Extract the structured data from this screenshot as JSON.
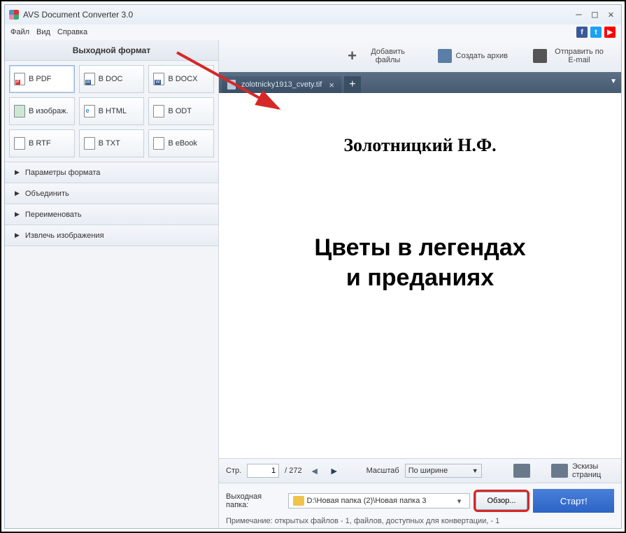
{
  "title": "AVS Document Converter 3.0",
  "menu": {
    "file": "Файл",
    "view": "Вид",
    "help": "Справка"
  },
  "sidebar": {
    "header": "Выходной формат",
    "formats": [
      {
        "label": "В PDF"
      },
      {
        "label": "В DOC"
      },
      {
        "label": "В DOCX"
      },
      {
        "label": "В изображ."
      },
      {
        "label": "В HTML"
      },
      {
        "label": "В ODT"
      },
      {
        "label": "В RTF"
      },
      {
        "label": "В TXT"
      },
      {
        "label": "В eBook"
      }
    ],
    "acc": [
      "Параметры формата",
      "Объединить",
      "Переименовать",
      "Извлечь изображения"
    ]
  },
  "toolbar": {
    "add": "Добавить файлы",
    "archive": "Создать архив",
    "email": "Отправить по E-mail"
  },
  "tab": {
    "name": "zolotnicky1913_cvety.tif"
  },
  "doc": {
    "author": "Золотницкий Н.Ф.",
    "title1": "Цветы в легендах",
    "title2": "и преданиях"
  },
  "pager": {
    "label": "Стр.",
    "page": "1",
    "total": "/ 272",
    "zoom_label": "Масштаб",
    "zoom_value": "По ширине",
    "thumbs": "Эскизы страниц"
  },
  "footer": {
    "out_label": "Выходная папка:",
    "path": "D:\\Новая папка (2)\\Новая папка 3",
    "browse": "Обзор...",
    "start": "Старт!",
    "note": "Примечание: открытых файлов - 1, файлов, доступных для конвертации, - 1"
  }
}
